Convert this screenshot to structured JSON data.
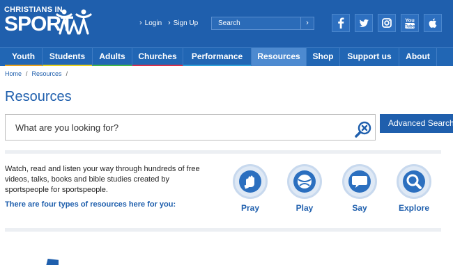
{
  "brand": {
    "logo_small": "CHRISTIANS IN",
    "logo_big": "SPORT"
  },
  "header": {
    "login": "Login",
    "signup": "Sign Up",
    "search_placeholder": "Search",
    "social": [
      "facebook-icon",
      "twitter-icon",
      "instagram-icon",
      "youtube-icon",
      "apple-icon"
    ],
    "youtube_text_top": "You",
    "youtube_text_bottom": "Tube"
  },
  "nav": {
    "items": [
      {
        "label": "Youth",
        "underline": "#e8a21c"
      },
      {
        "label": "Students",
        "underline": "#e8d21c"
      },
      {
        "label": "Adults",
        "underline": "#43b54a"
      },
      {
        "label": "Churches",
        "underline": "#d6304b"
      },
      {
        "label": "Performance",
        "underline": "#2f9fd8"
      },
      {
        "label": "Resources",
        "underline": "#4d8ad0"
      },
      {
        "label": "Shop",
        "underline": ""
      },
      {
        "label": "Support us",
        "underline": ""
      },
      {
        "label": "About",
        "underline": ""
      }
    ],
    "active": "Resources"
  },
  "breadcrumb": [
    "Home",
    "Resources"
  ],
  "page_title": "Resources",
  "main_search": {
    "placeholder": "What are you looking for?",
    "advanced_label": "Advanced Search"
  },
  "intro": {
    "text": "Watch, read and listen your way through hundreds of free videos, talks, books and bible studies created by sportspeople for sportspeople.",
    "four_types": "There are four types of resources here for you:"
  },
  "resource_types": [
    {
      "label": "Pray",
      "icon": "praying-hands-icon"
    },
    {
      "label": "Play",
      "icon": "ball-icon"
    },
    {
      "label": "Say",
      "icon": "speech-bubble-icon"
    },
    {
      "label": "Explore",
      "icon": "magnifier-icon"
    }
  ],
  "colors": {
    "brand_blue": "#1f5fad",
    "nav_blue": "#2166b4",
    "active_tab": "#4d8ad0"
  }
}
